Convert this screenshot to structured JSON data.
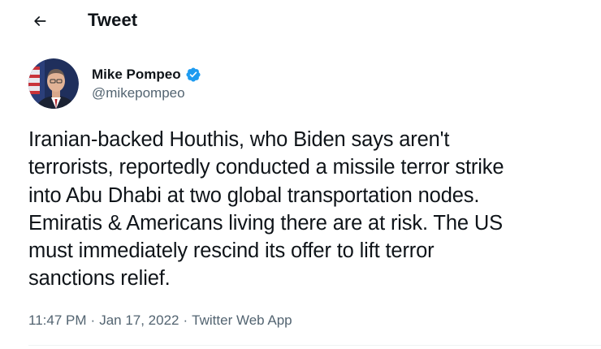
{
  "header": {
    "back_icon": "arrow-left-icon",
    "title": "Tweet"
  },
  "author": {
    "display_name": "Mike Pompeo",
    "handle": "@mikepompeo",
    "verified_icon": "verified-badge-icon",
    "verified_color": "#1d9bf0"
  },
  "tweet": {
    "text": "Iranian-backed Houthis, who Biden says aren't\nterrorists, reportedly conducted a missile terror strike\ninto Abu Dhabi at two global transportation nodes.\nEmiratis & Americans living there are at risk. The US\nmust immediately rescind its offer to lift terror\nsanctions relief."
  },
  "meta": {
    "time": "11:47 PM",
    "separator_1": "·",
    "date": "Jan 17, 2022",
    "separator_2": "·",
    "source": "Twitter Web App"
  }
}
